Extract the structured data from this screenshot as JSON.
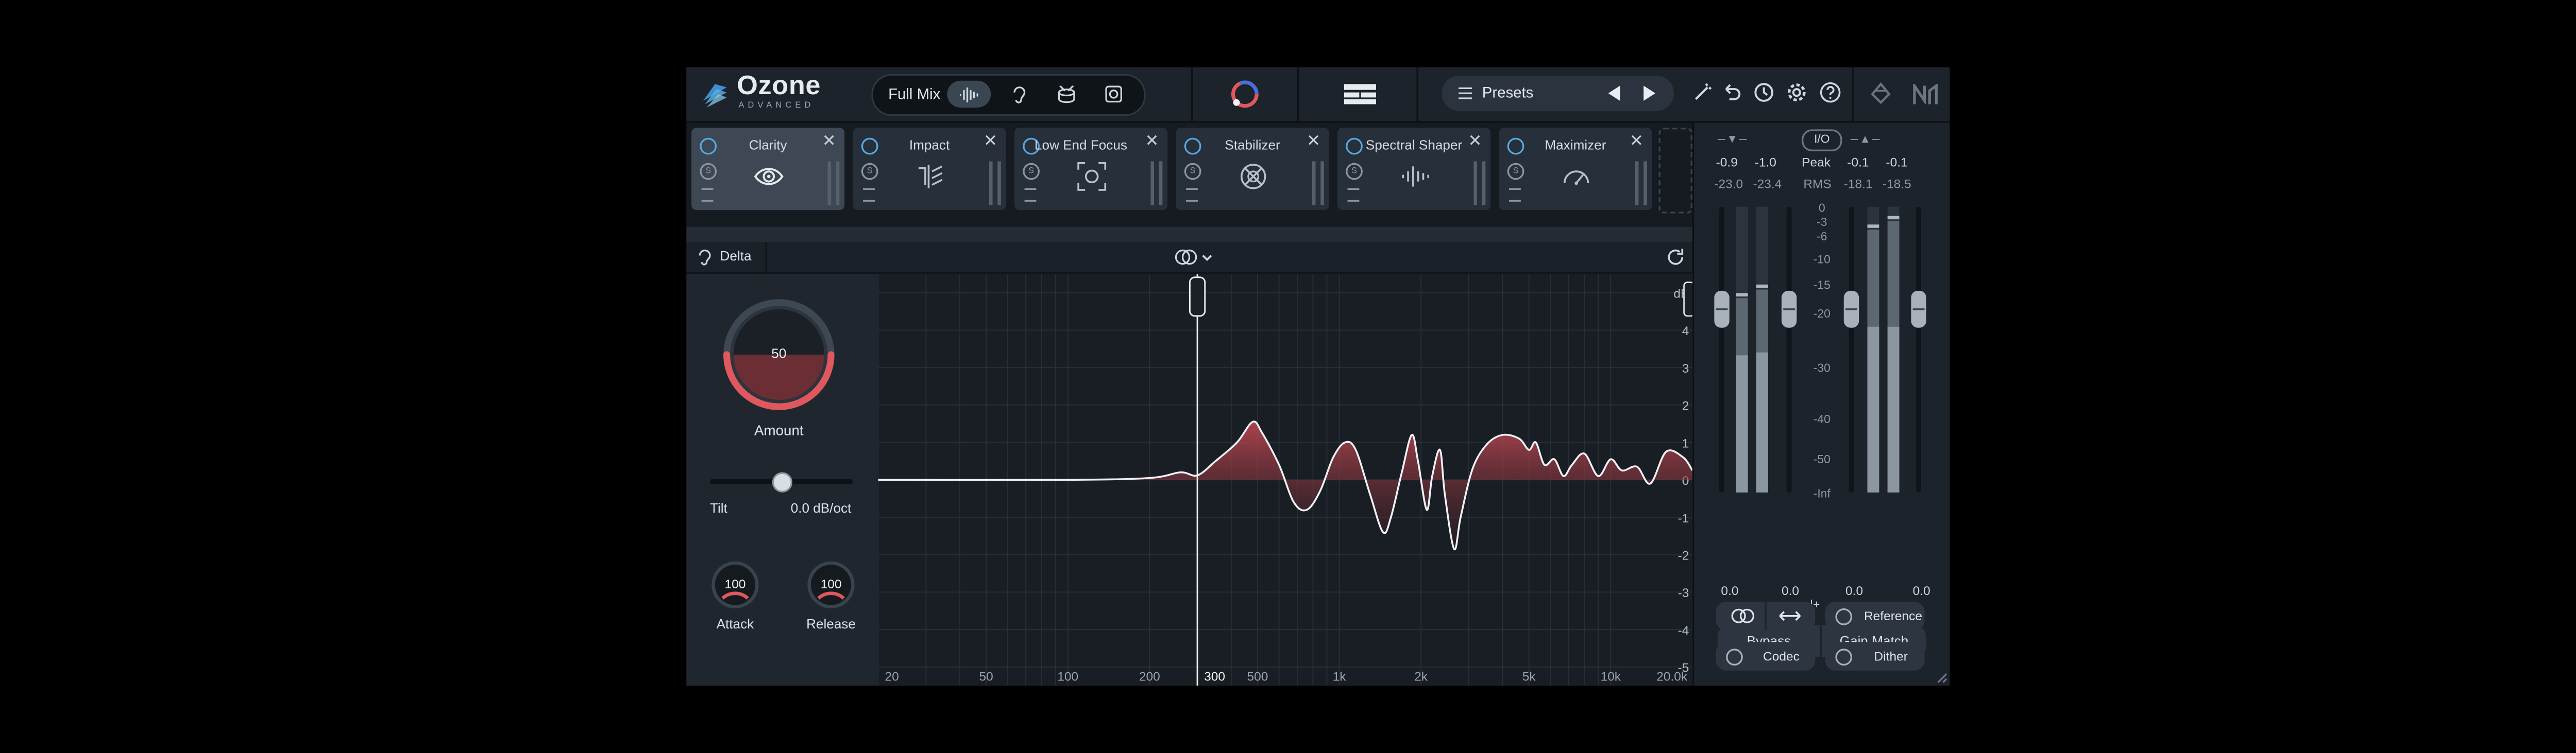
{
  "app": {
    "logo_name": "Ozone",
    "logo_subtitle": "ADVANCED"
  },
  "topbar": {
    "mix_label": "Full Mix",
    "mode_icons": [
      "waveform-icon",
      "ear-icon",
      "drum-icon",
      "speaker-icon"
    ],
    "presets_label": "Presets",
    "right_icons": [
      "wand-icon",
      "undo-icon",
      "history-icon",
      "gear-icon",
      "help-icon",
      "routing-icon",
      "ni-logo-icon"
    ]
  },
  "modules": [
    {
      "name": "Clarity",
      "active": true,
      "icon": "eye-icon"
    },
    {
      "name": "Impact",
      "active": false,
      "icon": "impact-icon"
    },
    {
      "name": "Low End Focus",
      "active": false,
      "icon": "focus-icon"
    },
    {
      "name": "Stabilizer",
      "active": false,
      "icon": "stabilizer-icon"
    },
    {
      "name": "Spectral Shaper",
      "active": false,
      "icon": "spectral-icon"
    },
    {
      "name": "Maximizer",
      "active": false,
      "icon": "gauge-icon"
    }
  ],
  "delta_label": "Delta",
  "controls": {
    "amount_value": "50",
    "amount_label": "Amount",
    "amount_level": 0.5,
    "tilt_label": "Tilt",
    "tilt_value": "0.0 dB/oct",
    "tilt_position": 0.5,
    "attack_value": "100",
    "attack_label": "Attack",
    "release_value": "100",
    "release_label": "Release"
  },
  "graph": {
    "db_unit": "dB",
    "db_ticks": [
      "4",
      "3",
      "2",
      "1",
      "0",
      "-1",
      "-2",
      "-3",
      "-4",
      "-5"
    ],
    "freq_ticks": [
      "20",
      "50",
      "100",
      "200",
      "300",
      "500",
      "1k",
      "2k",
      "5k",
      "10k",
      "20.0k"
    ],
    "marker_freq": "300",
    "curve": [
      [
        20,
        0
      ],
      [
        100,
        0
      ],
      [
        200,
        0.05
      ],
      [
        260,
        0.2
      ],
      [
        300,
        0.12
      ],
      [
        350,
        0.5
      ],
      [
        420,
        1.0
      ],
      [
        480,
        1.55
      ],
      [
        520,
        1.25
      ],
      [
        600,
        0.4
      ],
      [
        680,
        -0.6
      ],
      [
        760,
        -0.8
      ],
      [
        850,
        -0.3
      ],
      [
        950,
        0.6
      ],
      [
        1050,
        1.0
      ],
      [
        1150,
        0.8
      ],
      [
        1300,
        -0.4
      ],
      [
        1450,
        -1.4
      ],
      [
        1550,
        -1.0
      ],
      [
        1700,
        0.2
      ],
      [
        1850,
        1.2
      ],
      [
        1950,
        0.5
      ],
      [
        2100,
        -0.8
      ],
      [
        2200,
        0.1
      ],
      [
        2350,
        0.8
      ],
      [
        2450,
        -0.4
      ],
      [
        2650,
        -1.85
      ],
      [
        2800,
        -1.0
      ],
      [
        3100,
        0.3
      ],
      [
        3500,
        0.95
      ],
      [
        4000,
        1.2
      ],
      [
        4600,
        1.1
      ],
      [
        5000,
        0.8
      ],
      [
        5300,
        1.0
      ],
      [
        5700,
        0.4
      ],
      [
        6200,
        0.55
      ],
      [
        6700,
        0.1
      ],
      [
        7200,
        0.4
      ],
      [
        8000,
        0.7
      ],
      [
        9000,
        0.1
      ],
      [
        10000,
        0.55
      ],
      [
        11000,
        0.25
      ],
      [
        12500,
        0.35
      ],
      [
        14000,
        -0.1
      ],
      [
        16000,
        0.75
      ],
      [
        18500,
        0.6
      ],
      [
        20000,
        0.25
      ]
    ]
  },
  "meters": {
    "in_peak": [
      "-0.9",
      "-1.0"
    ],
    "in_rms": [
      "-23.0",
      "-23.4"
    ],
    "out_peak": [
      "-0.1",
      "-0.1"
    ],
    "out_rms": [
      "-18.1",
      "-18.5"
    ],
    "peak_label": "Peak",
    "rms_label": "RMS",
    "io_label": "I/O",
    "scale": [
      "0",
      "-3",
      "-6",
      "-10",
      "-15",
      "-20",
      "-30",
      "-40",
      "-50",
      "-Inf"
    ],
    "bottom_values": [
      "0.0",
      "0.0",
      "0.0",
      "0.0"
    ],
    "in_levels": [
      0.68,
      0.71
    ],
    "out_levels": [
      0.92,
      0.95
    ]
  },
  "buttons": {
    "bypass": "Bypass",
    "gain_match": "Gain Match",
    "reference": "Reference",
    "codec": "Codec",
    "dither": "Dither"
  },
  "colors": {
    "accent_red": "#e0575e",
    "accent_blue": "#58a9e0",
    "bg": "#1a2028"
  }
}
